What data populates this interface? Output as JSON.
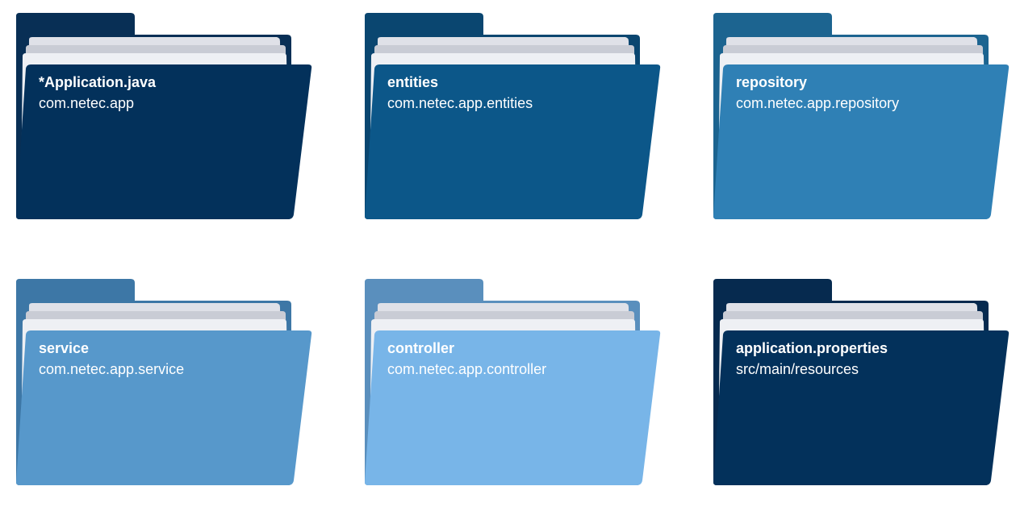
{
  "folders": [
    {
      "name": "*Application.java",
      "package": "com.netec.app",
      "back": "#082f55",
      "front": "#03315b"
    },
    {
      "name": "entities",
      "package": "com.netec.app.entities",
      "back": "#0a4670",
      "front": "#0c5789"
    },
    {
      "name": "repository",
      "package": "com.netec.app.repository",
      "back": "#1c6490",
      "front": "#2f80b5"
    },
    {
      "name": "service",
      "package": "com.netec.app.service",
      "back": "#3d77a6",
      "front": "#5798cb"
    },
    {
      "name": "controller",
      "package": "com.netec.app.controller",
      "back": "#5a8fbd",
      "front": "#78b5e8"
    },
    {
      "name": "application.properties",
      "package": "src/main/resources",
      "back": "#062a4f",
      "front": "#03315b"
    }
  ]
}
